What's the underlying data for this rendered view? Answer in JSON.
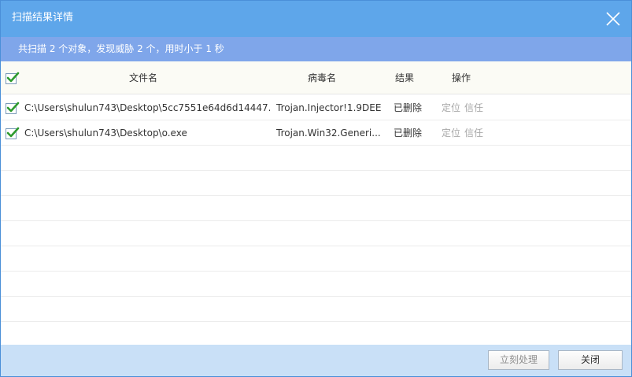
{
  "window": {
    "title": "扫描结果详情"
  },
  "summary": {
    "text": "共扫描 2 个对象，发现威胁 2 个，用时小于 1 秒"
  },
  "table": {
    "columns": {
      "file": "文件名",
      "virus": "病毒名",
      "result": "结果",
      "action": "操作"
    },
    "rows": [
      {
        "file": "C:\\Users\\shulun743\\Desktop\\5cc7551e64d6d14447...",
        "virus": "Trojan.Injector!1.9DEE",
        "result": "已删除",
        "locate": "定位",
        "trust": "信任"
      },
      {
        "file": "C:\\Users\\shulun743\\Desktop\\o.exe",
        "virus": "Trojan.Win32.Generi...",
        "result": "已删除",
        "locate": "定位",
        "trust": "信任"
      }
    ]
  },
  "footer": {
    "process_label": "立刻处理",
    "close_label": "关闭"
  },
  "colors": {
    "titlebar": "#5ea6ea",
    "summary": "#7fa6ea",
    "check": "#2e9b2e",
    "footer": "#c9e0f7"
  }
}
